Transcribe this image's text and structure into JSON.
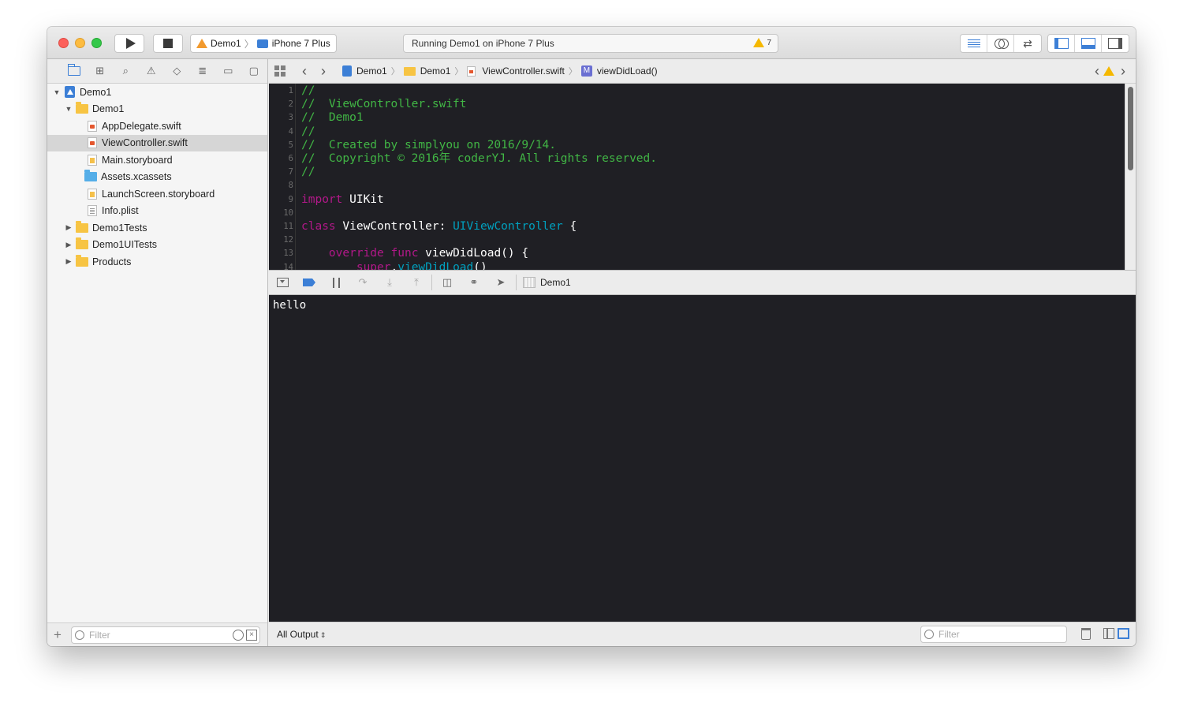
{
  "toolbar": {
    "scheme_project": "Demo1",
    "scheme_device": "iPhone 7 Plus",
    "activity_text": "Running Demo1 on iPhone 7 Plus",
    "warning_count": "7"
  },
  "navigator": {
    "tree": [
      {
        "label": "Demo1",
        "level": 0,
        "kind": "project",
        "expanded": true
      },
      {
        "label": "Demo1",
        "level": 1,
        "kind": "folder",
        "expanded": true
      },
      {
        "label": "AppDelegate.swift",
        "level": 2,
        "kind": "swift"
      },
      {
        "label": "ViewController.swift",
        "level": 2,
        "kind": "swift",
        "selected": true
      },
      {
        "label": "Main.storyboard",
        "level": 2,
        "kind": "storyboard"
      },
      {
        "label": "Assets.xcassets",
        "level": 2,
        "kind": "assets"
      },
      {
        "label": "LaunchScreen.storyboard",
        "level": 2,
        "kind": "storyboard"
      },
      {
        "label": "Info.plist",
        "level": 2,
        "kind": "plist"
      },
      {
        "label": "Demo1Tests",
        "level": 1,
        "kind": "folder",
        "expanded": false
      },
      {
        "label": "Demo1UITests",
        "level": 1,
        "kind": "folder",
        "expanded": false
      },
      {
        "label": "Products",
        "level": 1,
        "kind": "folder",
        "expanded": false
      }
    ],
    "filter_placeholder": "Filter"
  },
  "jumpbar": {
    "crumbs": [
      "Demo1",
      "Demo1",
      "ViewController.swift",
      "viewDidLoad()"
    ],
    "method_badge": "M"
  },
  "editor": {
    "lines": [
      {
        "n": "1",
        "tokens": [
          {
            "t": "//",
            "c": "comment"
          }
        ]
      },
      {
        "n": "2",
        "tokens": [
          {
            "t": "//  ViewController.swift",
            "c": "comment"
          }
        ]
      },
      {
        "n": "3",
        "tokens": [
          {
            "t": "//  Demo1",
            "c": "comment"
          }
        ]
      },
      {
        "n": "4",
        "tokens": [
          {
            "t": "//",
            "c": "comment"
          }
        ]
      },
      {
        "n": "5",
        "tokens": [
          {
            "t": "//  Created by simplyou on 2016/9/14.",
            "c": "comment"
          }
        ]
      },
      {
        "n": "6",
        "tokens": [
          {
            "t": "//  Copyright © 2016年 coderYJ. All rights reserved.",
            "c": "comment"
          }
        ]
      },
      {
        "n": "7",
        "tokens": [
          {
            "t": "//",
            "c": "comment"
          }
        ]
      },
      {
        "n": "8",
        "tokens": []
      },
      {
        "n": "9",
        "tokens": [
          {
            "t": "import",
            "c": "keyword"
          },
          {
            "t": " UIKit",
            "c": "plain"
          }
        ]
      },
      {
        "n": "10",
        "tokens": []
      },
      {
        "n": "11",
        "tokens": [
          {
            "t": "class",
            "c": "keyword"
          },
          {
            "t": " ViewController: ",
            "c": "plain"
          },
          {
            "t": "UIViewController",
            "c": "type"
          },
          {
            "t": " {",
            "c": "plain"
          }
        ]
      },
      {
        "n": "12",
        "tokens": []
      },
      {
        "n": "13",
        "tokens": [
          {
            "t": "    override",
            "c": "keyword"
          },
          {
            "t": " ",
            "c": "plain"
          },
          {
            "t": "func",
            "c": "keyword"
          },
          {
            "t": " viewDidLoad() {",
            "c": "plain"
          }
        ]
      },
      {
        "n": "14",
        "tokens": [
          {
            "t": "        super",
            "c": "keyword"
          },
          {
            "t": ".",
            "c": "plain"
          },
          {
            "t": "viewDidLoad",
            "c": "type"
          },
          {
            "t": "()",
            "c": "plain"
          }
        ]
      }
    ]
  },
  "debugbar": {
    "target_label": "Demo1"
  },
  "console": {
    "output": "hello",
    "output_scope": "All Output",
    "filter_placeholder": "Filter"
  }
}
